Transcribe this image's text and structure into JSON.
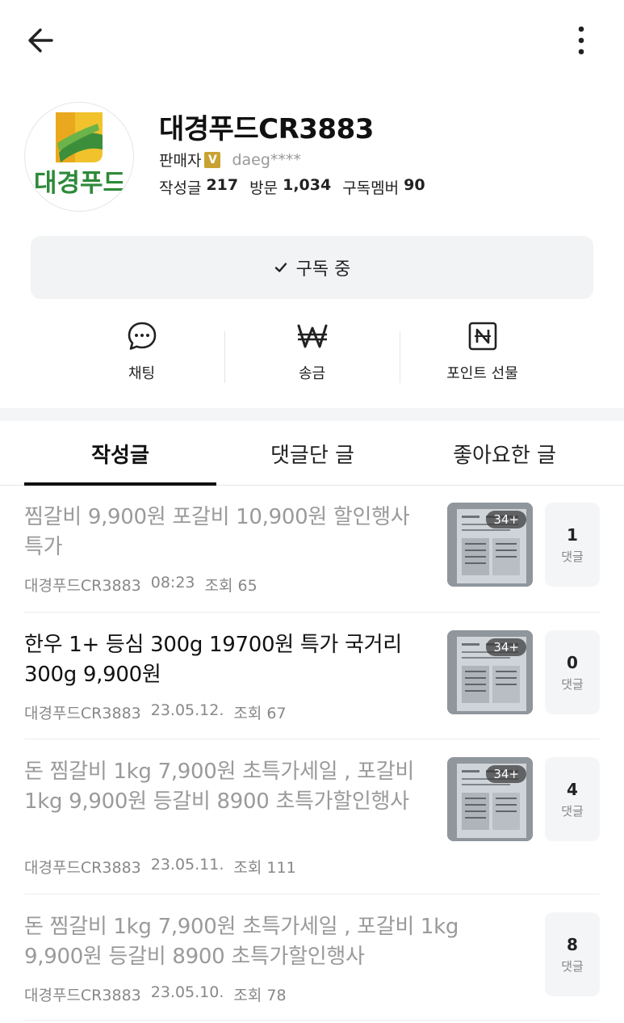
{
  "header": {
    "back_icon": "arrow-left-icon",
    "more_icon": "more-vertical-icon"
  },
  "profile": {
    "avatar_text": "대경푸드",
    "name": "대경푸드CR3883",
    "role": "판매자",
    "verified_badge": "V",
    "user_id": "daeg****",
    "stats": [
      {
        "label": "작성글",
        "value": "217"
      },
      {
        "label": "방문",
        "value": "1,034"
      },
      {
        "label": "구독멤버",
        "value": "90"
      }
    ]
  },
  "subscribe": {
    "label": "구독 중",
    "icon": "check-icon"
  },
  "actions": [
    {
      "label": "채팅",
      "icon": "chat-bubble-icon"
    },
    {
      "label": "송금",
      "icon": "won-icon"
    },
    {
      "label": "포인트 선물",
      "icon": "naver-point-icon"
    }
  ],
  "tabs": [
    {
      "label": "작성글",
      "active": true
    },
    {
      "label": "댓글단 글",
      "active": false
    },
    {
      "label": "좋아요한 글",
      "active": false
    }
  ],
  "posts": [
    {
      "title": "찜갈비 9,900원 포갈비 10,900원 할인행사 특가",
      "author": "대경푸드CR3883",
      "date": "08:23",
      "views": "조회 65",
      "thumb_count": "34+",
      "comments": "1",
      "comments_label": "댓글",
      "read": true
    },
    {
      "title": "한우 1+ 등심 300g 19700원 특가 국거리 300g 9,900원",
      "author": "대경푸드CR3883",
      "date": "23.05.12.",
      "views": "조회 67",
      "thumb_count": "34+",
      "comments": "0",
      "comments_label": "댓글",
      "read": false
    },
    {
      "title": "돈 찜갈비 1kg 7,900원 초특가세일 , 포갈비 1kg 9,900원 등갈비 8900 초특가할인행사",
      "author": "대경푸드CR3883",
      "date": "23.05.11.",
      "views": "조회 111",
      "thumb_count": "34+",
      "comments": "4",
      "comments_label": "댓글",
      "read": true
    },
    {
      "title": "돈 찜갈비 1kg 7,900원 초특가세일 , 포갈비 1kg 9,900원 등갈비 8900 초특가할인행사",
      "author": "대경푸드CR3883",
      "date": "23.05.10.",
      "views": "조회 78",
      "thumb_count": "",
      "comments": "8",
      "comments_label": "댓글",
      "read": true
    }
  ]
}
